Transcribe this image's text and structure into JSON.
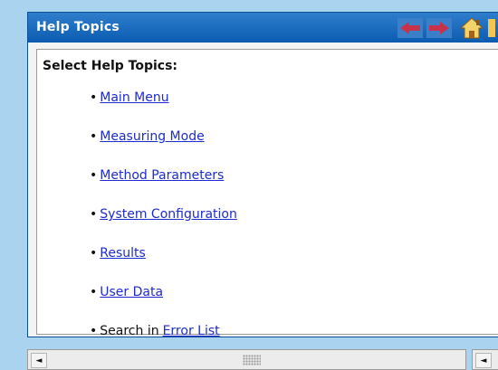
{
  "window": {
    "title": "Help Topics",
    "toolbar": {
      "back_icon": "back-arrow-icon",
      "forward_icon": "forward-arrow-icon",
      "home_icon": "home-icon"
    }
  },
  "content": {
    "heading": "Select Help Topics:",
    "topics": [
      {
        "prefix": "",
        "label": "Main Menu"
      },
      {
        "prefix": "",
        "label": "Measuring Mode"
      },
      {
        "prefix": "",
        "label": "Method Parameters"
      },
      {
        "prefix": "",
        "label": "System Configuration"
      },
      {
        "prefix": "",
        "label": "Results"
      },
      {
        "prefix": "",
        "label": "User Data"
      },
      {
        "prefix": "Search in",
        "label": "Error List"
      }
    ]
  },
  "scrollbar": {
    "left_arrow": "◄"
  },
  "colors": {
    "titlebar": "#0b5bb1",
    "link": "#1d2bd0",
    "background": "#a9d3ee"
  }
}
